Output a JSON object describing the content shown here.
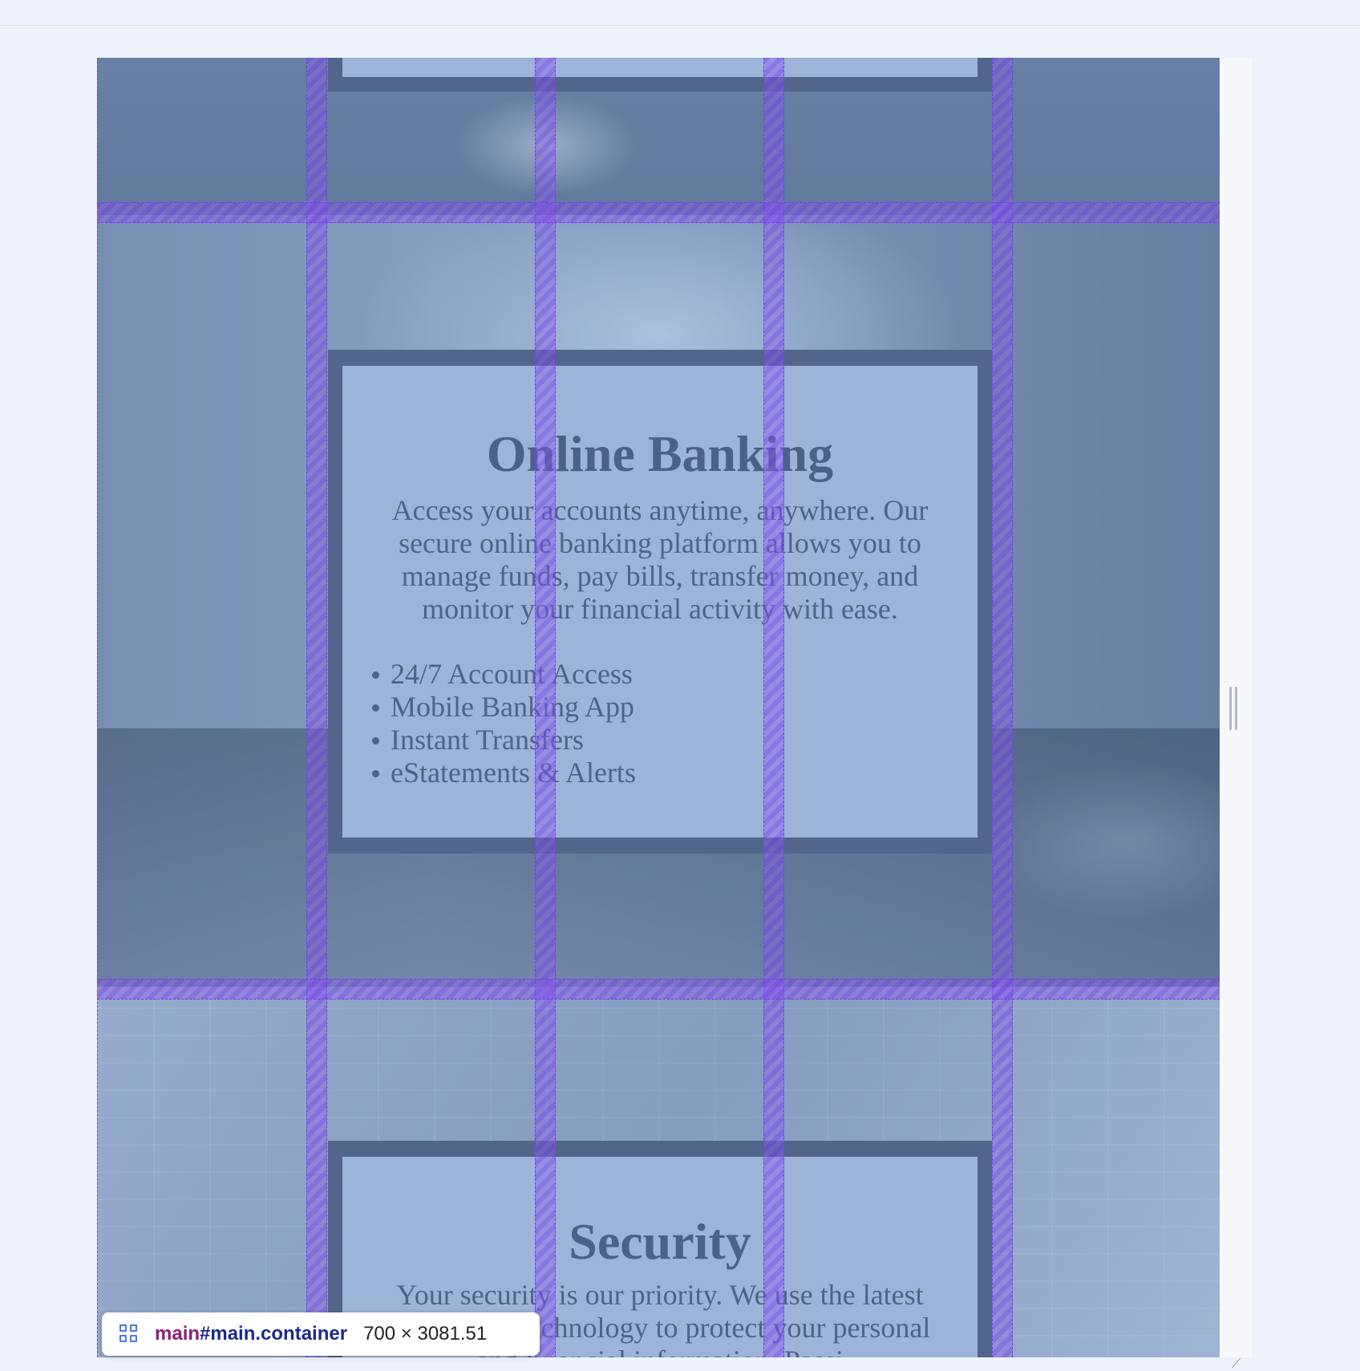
{
  "sections": {
    "banking": {
      "title": "Online Banking",
      "description": "Access your accounts anytime, anywhere. Our secure online banking platform allows you to manage funds, pay bills, transfer money, and monitor your financial activity with ease.",
      "features": [
        "24/7 Account Access",
        "Mobile Banking App",
        "Instant Transfers",
        "eStatements & Alerts"
      ]
    },
    "security": {
      "title": "Security",
      "description": "Your security is our priority. We use the latest encryption technology to protect your personal and financial information. Passi"
    }
  },
  "inspector_badge": {
    "tag": "main",
    "id_class": "#main.container",
    "dimensions": "700 × 3081.51"
  },
  "colors": {
    "grid_overlay": "#7a3cf0",
    "card_border": "#53698a",
    "card_fill": "#aac4e4",
    "text": "#4d6386"
  },
  "icons": {
    "grid": "grid-layout-icon",
    "resize": "resize-handle-icon"
  }
}
